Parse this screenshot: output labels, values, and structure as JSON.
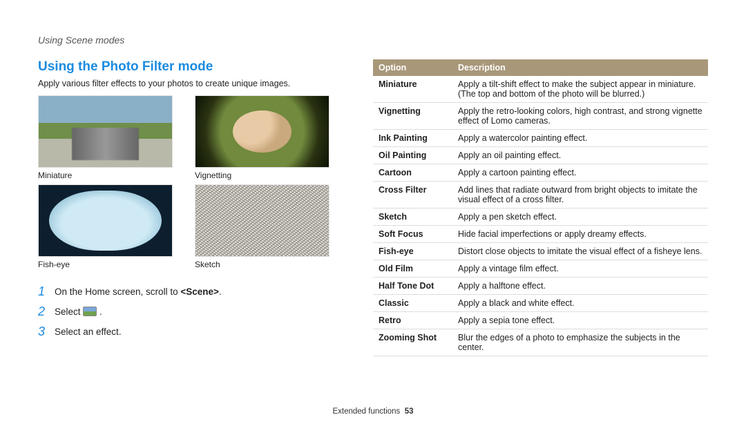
{
  "breadcrumb": "Using Scene modes",
  "section_title": "Using the Photo Filter mode",
  "intro": "Apply various filter effects to your photos to create unique images.",
  "thumbs": {
    "miniature": "Miniature",
    "vignetting": "Vignetting",
    "fisheye": "Fish-eye",
    "sketch": "Sketch"
  },
  "steps": {
    "s1a": "On the Home screen, scroll to ",
    "s1b": "<Scene>",
    "s1c": ".",
    "s2a": "Select ",
    "s2b": ".",
    "s3": "Select an effect."
  },
  "table": {
    "head_option": "Option",
    "head_desc": "Description",
    "rows": [
      {
        "opt": "Miniature",
        "desc": "Apply a tilt-shift effect to make the subject appear in miniature. (The top and bottom of the photo will be blurred.)"
      },
      {
        "opt": "Vignetting",
        "desc": "Apply the retro-looking colors, high contrast, and strong vignette effect of Lomo cameras."
      },
      {
        "opt": "Ink Painting",
        "desc": "Apply a watercolor painting effect."
      },
      {
        "opt": "Oil Painting",
        "desc": "Apply an oil painting effect."
      },
      {
        "opt": "Cartoon",
        "desc": "Apply a cartoon painting effect."
      },
      {
        "opt": "Cross Filter",
        "desc": "Add lines that radiate outward from bright objects to imitate the visual effect of a cross filter."
      },
      {
        "opt": "Sketch",
        "desc": "Apply a pen sketch effect."
      },
      {
        "opt": "Soft Focus",
        "desc": "Hide facial imperfections or apply dreamy effects."
      },
      {
        "opt": "Fish-eye",
        "desc": "Distort close objects to imitate the visual effect of a fisheye lens."
      },
      {
        "opt": "Old Film",
        "desc": "Apply a vintage film effect."
      },
      {
        "opt": "Half Tone Dot",
        "desc": "Apply a halftone effect."
      },
      {
        "opt": "Classic",
        "desc": "Apply a black and white effect."
      },
      {
        "opt": "Retro",
        "desc": "Apply a sepia tone effect."
      },
      {
        "opt": "Zooming Shot",
        "desc": "Blur the edges of a photo to emphasize the subjects in the center."
      }
    ]
  },
  "footer": {
    "label": "Extended functions",
    "page": "53"
  }
}
